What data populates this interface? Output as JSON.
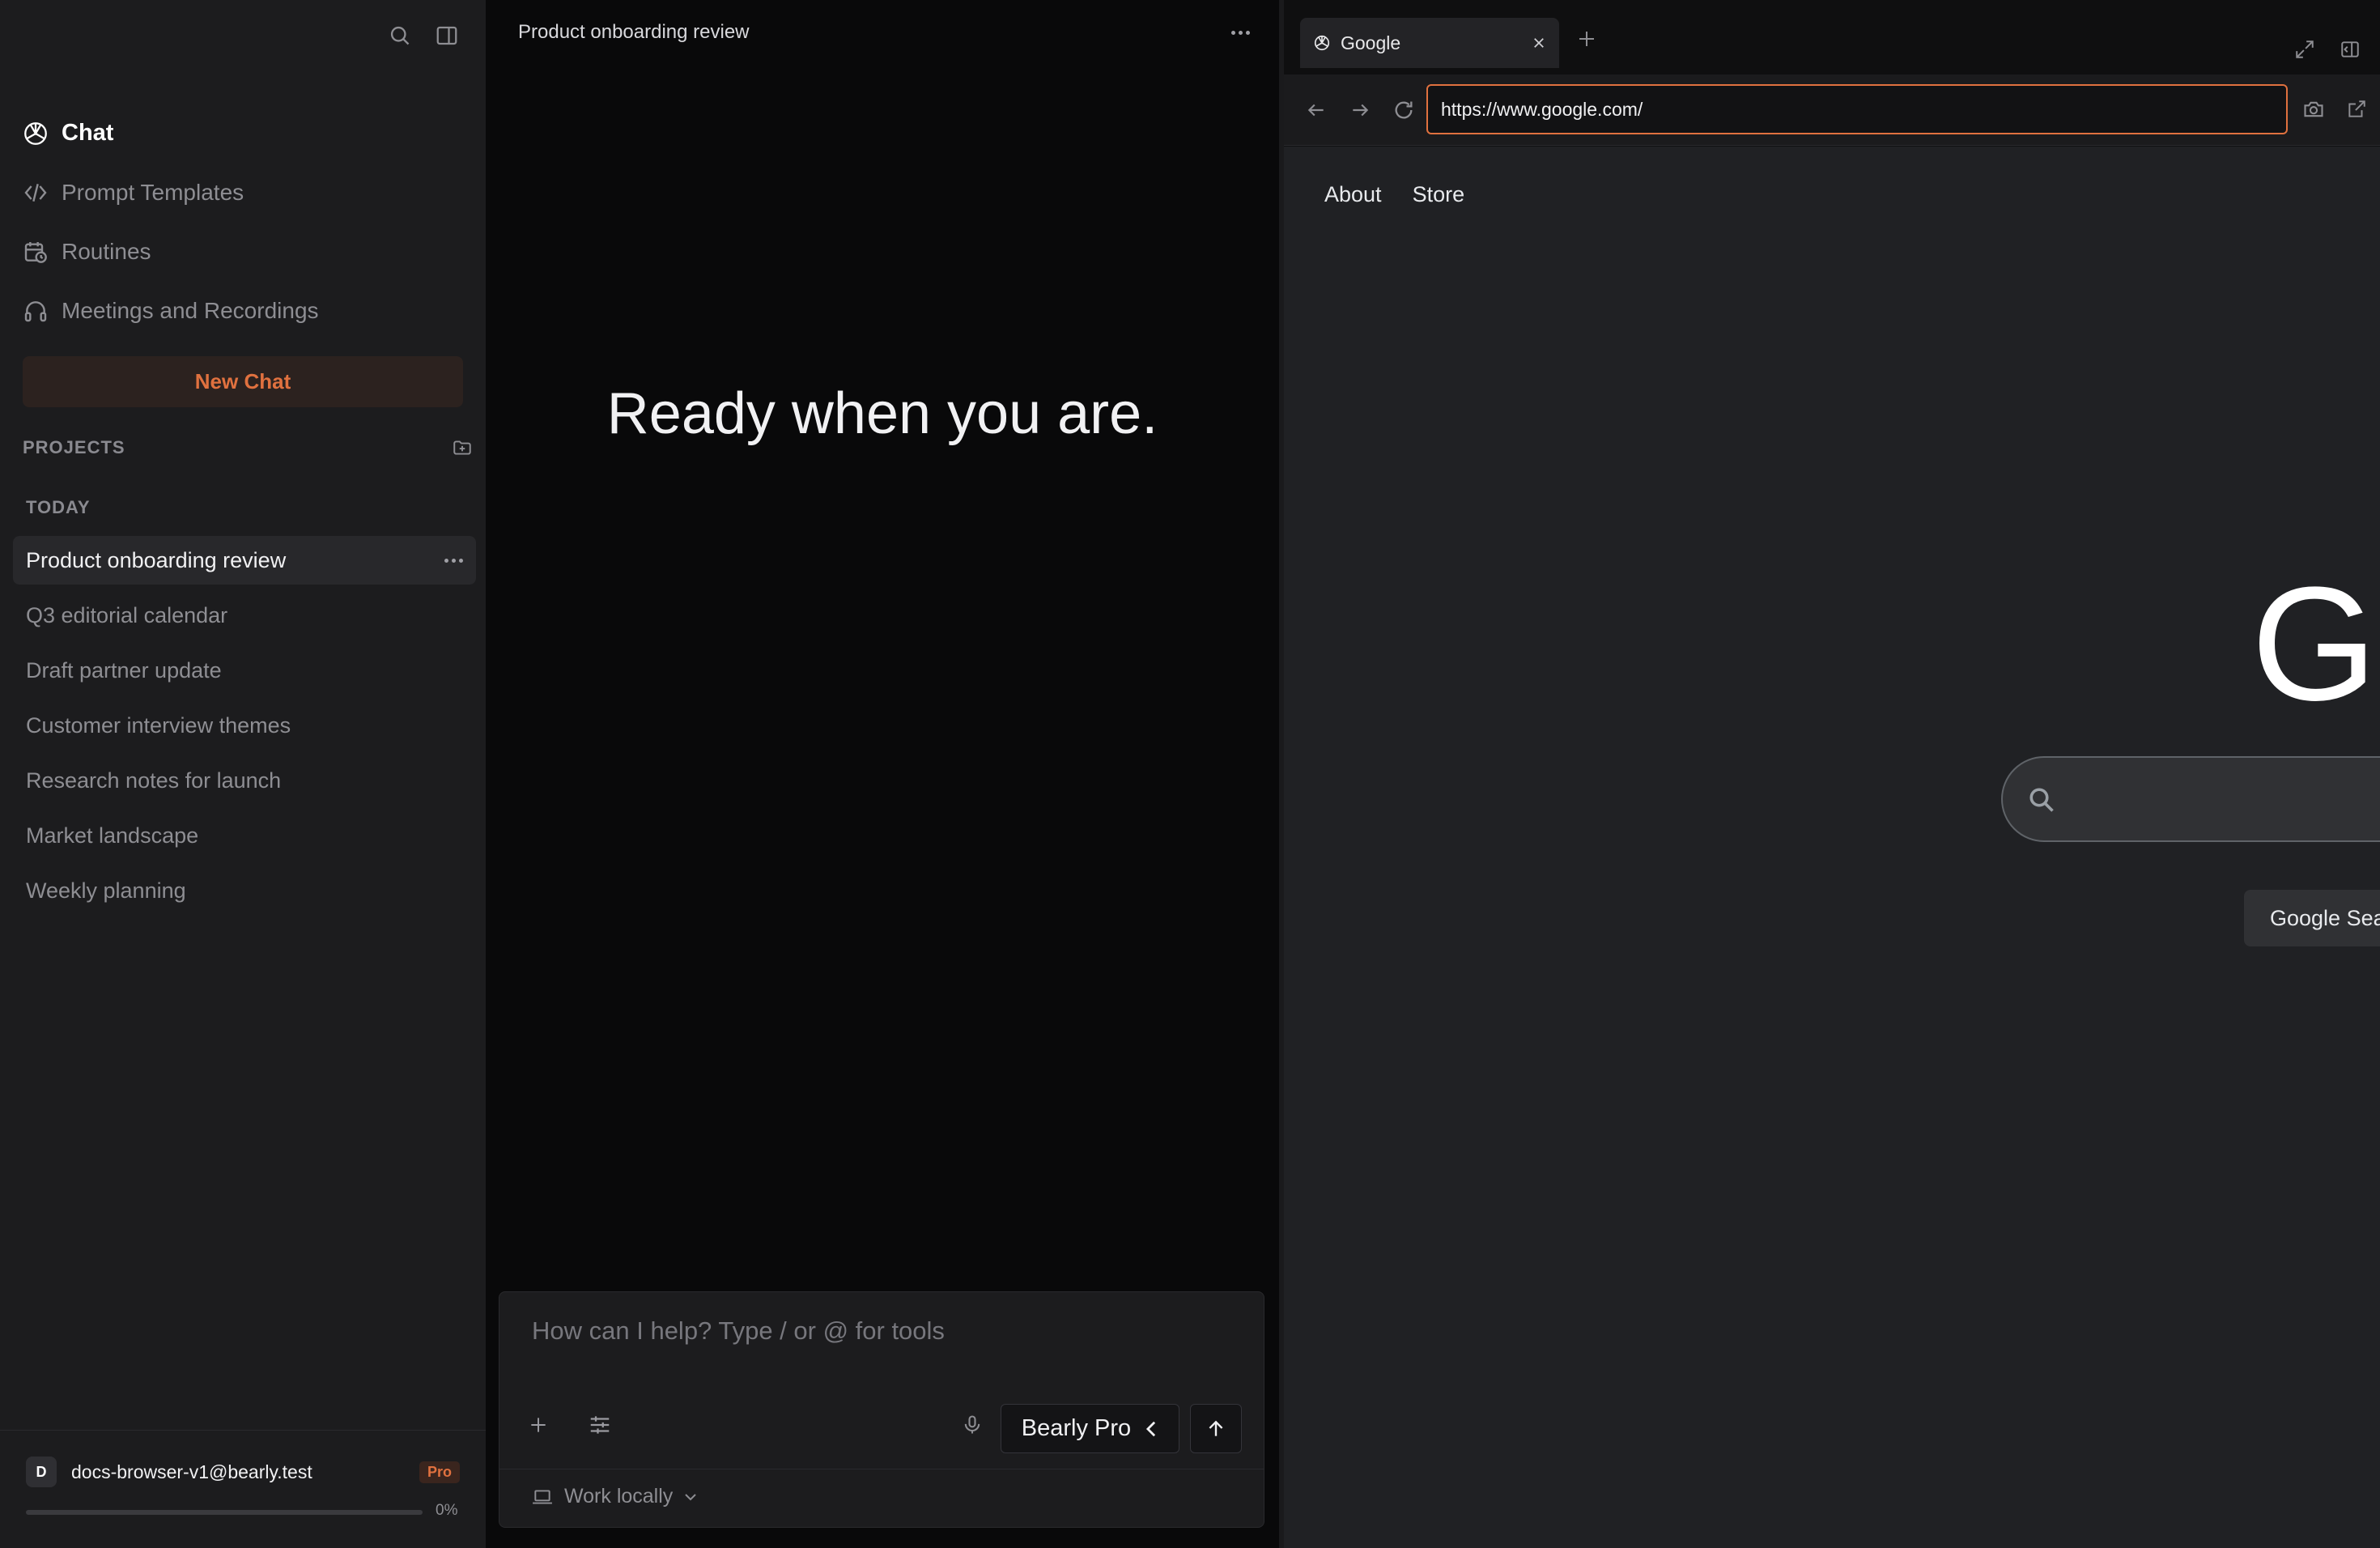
{
  "sidebar": {
    "nav": [
      {
        "label": "Chat",
        "icon": "openai-logo-icon"
      },
      {
        "label": "Prompt Templates",
        "icon": "code-prompt-icon"
      },
      {
        "label": "Routines",
        "icon": "calendar-clock-icon"
      },
      {
        "label": "Meetings and Recordings",
        "icon": "headphones-icon"
      }
    ],
    "new_chat_label": "New Chat",
    "projects_label": "PROJECTS",
    "today_label": "TODAY",
    "chats": [
      {
        "label": "Product onboarding review"
      },
      {
        "label": "Q3 editorial calendar"
      },
      {
        "label": "Draft partner update"
      },
      {
        "label": "Customer interview themes"
      },
      {
        "label": "Research notes for launch"
      },
      {
        "label": "Market landscape"
      },
      {
        "label": "Weekly planning"
      }
    ],
    "user": {
      "initial": "D",
      "email": "docs-browser-v1@bearly.test",
      "plan": "Pro",
      "usage_percent": 0,
      "usage_label": "0%"
    }
  },
  "chat": {
    "title": "Product onboarding review",
    "hero": "Ready when you are.",
    "composer": {
      "placeholder": "How can I help? Type / or @ for tools",
      "model": "Bearly Pro",
      "workspace": "Work locally"
    }
  },
  "browser": {
    "tab_title": "Google",
    "url": "https://www.google.com/",
    "page": {
      "links": [
        "About",
        "Store"
      ],
      "logo": "Go",
      "search_button": "Google Sea"
    }
  },
  "colors": {
    "accent": "#e0713f",
    "sidebar_bg": "#1c1c1e",
    "chat_bg": "#09090a",
    "google_bg": "#202124"
  }
}
